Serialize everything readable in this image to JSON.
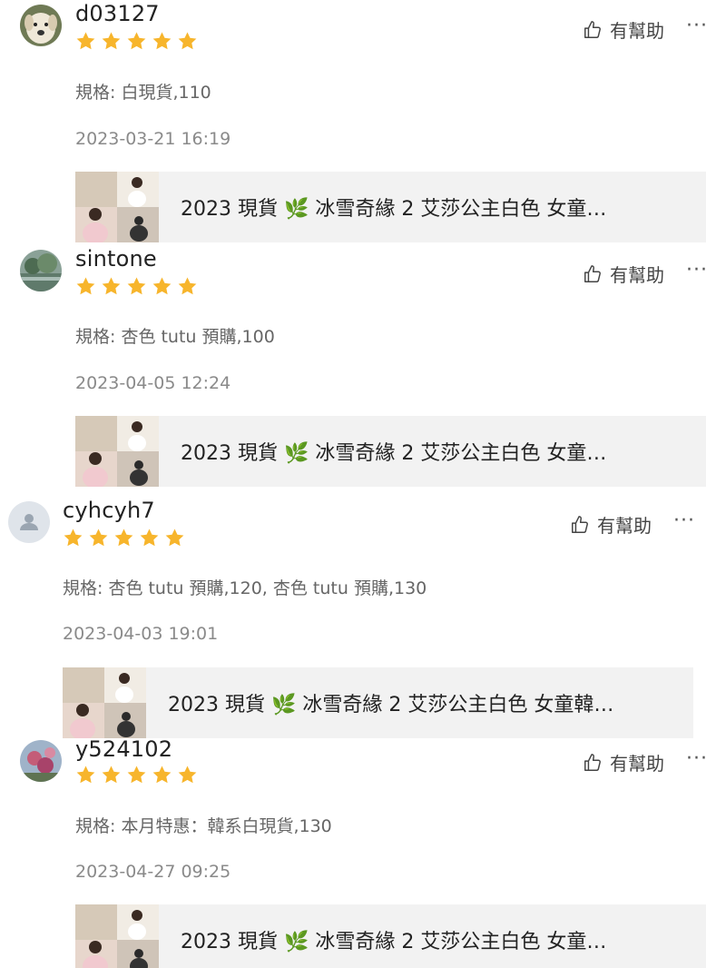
{
  "helpful_label": "有幫助",
  "more_label": "···",
  "colors": {
    "star": "#f7b52c",
    "product_bg": "#f2f2f2",
    "spec": "#666666",
    "date": "#8a8a8a"
  },
  "icons": {
    "helpful": "thumbs-up-icon",
    "more": "more-dots-icon",
    "leaf": "leaf-emoji"
  },
  "reviews": [
    {
      "username": "d03127",
      "rating": 5,
      "avatar": "dog-photo",
      "spec": "規格: 白現貨,110",
      "date": "2023-03-21 16:19",
      "product_title": "2023 現貨 🌿 冰雪奇緣 2 艾莎公主白色 女童…"
    },
    {
      "username": "sintone",
      "rating": 5,
      "avatar": "landscape-photo",
      "spec": "規格: 杏色 tutu 預購,100",
      "date": "2023-04-05 12:24",
      "product_title": "2023 現貨 🌿 冰雪奇緣 2 艾莎公主白色 女童…"
    },
    {
      "username": "cyhcyh7",
      "rating": 5,
      "avatar": "default-user-avatar",
      "spec": "規格: 杏色 tutu 預購,120, 杏色 tutu 預購,130",
      "date": "2023-04-03 19:01",
      "product_title": "2023 現貨 🌿 冰雪奇緣 2 艾莎公主白色 女童韓…"
    },
    {
      "username": "y524102",
      "rating": 5,
      "avatar": "flowers-photo",
      "spec": "規格: 本月特惠：韓系白現貨,130",
      "date": "2023-04-27 09:25",
      "product_title": "2023 現貨 🌿 冰雪奇緣 2 艾莎公主白色 女童…"
    }
  ]
}
